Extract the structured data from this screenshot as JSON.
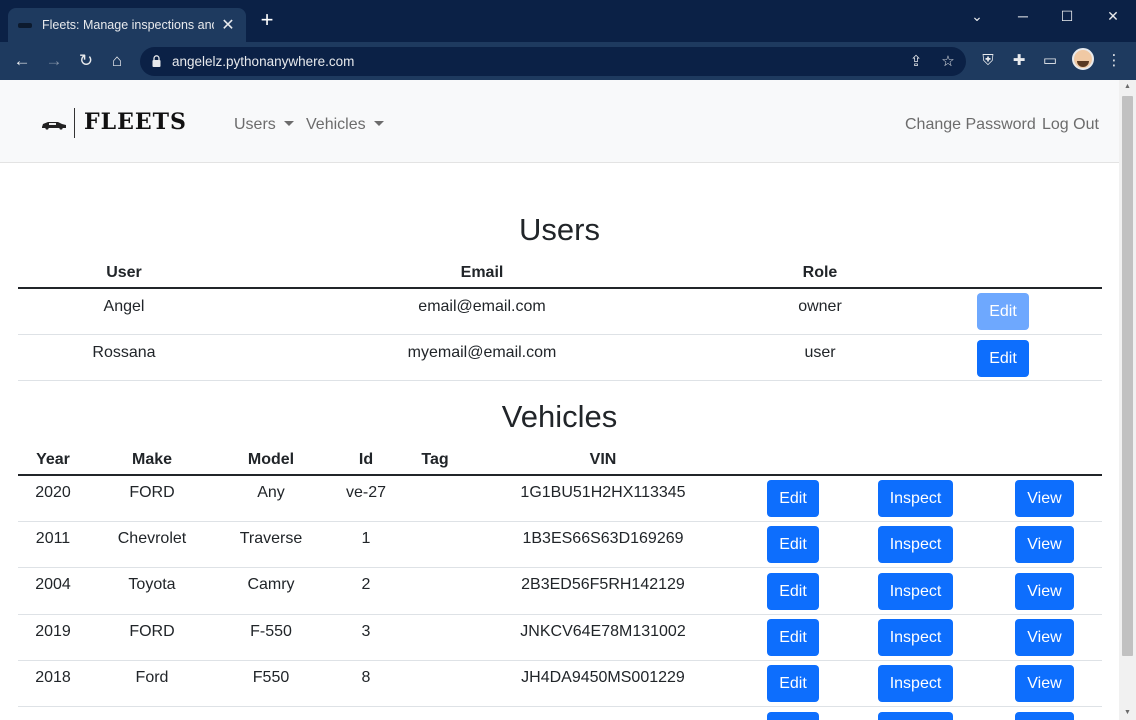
{
  "browser": {
    "tab_title": "Fleets: Manage inspections and/c",
    "url": "angelelz.pythonanywhere.com"
  },
  "site": {
    "brand": "FLEETS",
    "nav_users": "Users",
    "nav_vehicles": "Vehicles",
    "change_password": "Change Password",
    "log_out": "Log Out"
  },
  "users_section": {
    "title": "Users",
    "headers": {
      "user": "User",
      "email": "Email",
      "role": "Role"
    },
    "rows": [
      {
        "user": "Angel",
        "email": "email@email.com",
        "role": "owner",
        "edit": "Edit",
        "edit_disabled": true
      },
      {
        "user": "Rossana",
        "email": "myemail@email.com",
        "role": "user",
        "edit": "Edit",
        "edit_disabled": false
      }
    ]
  },
  "vehicles_section": {
    "title": "Vehicles",
    "headers": {
      "year": "Year",
      "make": "Make",
      "model": "Model",
      "id": "Id",
      "tag": "Tag",
      "vin": "VIN"
    },
    "buttons": {
      "edit": "Edit",
      "inspect": "Inspect",
      "view": "View"
    },
    "rows": [
      {
        "year": "2020",
        "make": "FORD",
        "model": "Any",
        "id": "ve-27",
        "tag": "",
        "vin": "1G1BU51H2HX113345"
      },
      {
        "year": "2011",
        "make": "Chevrolet",
        "model": "Traverse",
        "id": "1",
        "tag": "",
        "vin": "1B3ES66S63D169269"
      },
      {
        "year": "2004",
        "make": "Toyota",
        "model": "Camry",
        "id": "2",
        "tag": "",
        "vin": "2B3ED56F5RH142129"
      },
      {
        "year": "2019",
        "make": "FORD",
        "model": "F-550",
        "id": "3",
        "tag": "",
        "vin": "JNKCV64E78M131002"
      },
      {
        "year": "2018",
        "make": "Ford",
        "model": "F550",
        "id": "8",
        "tag": "",
        "vin": "JH4DA9450MS001229"
      }
    ]
  }
}
